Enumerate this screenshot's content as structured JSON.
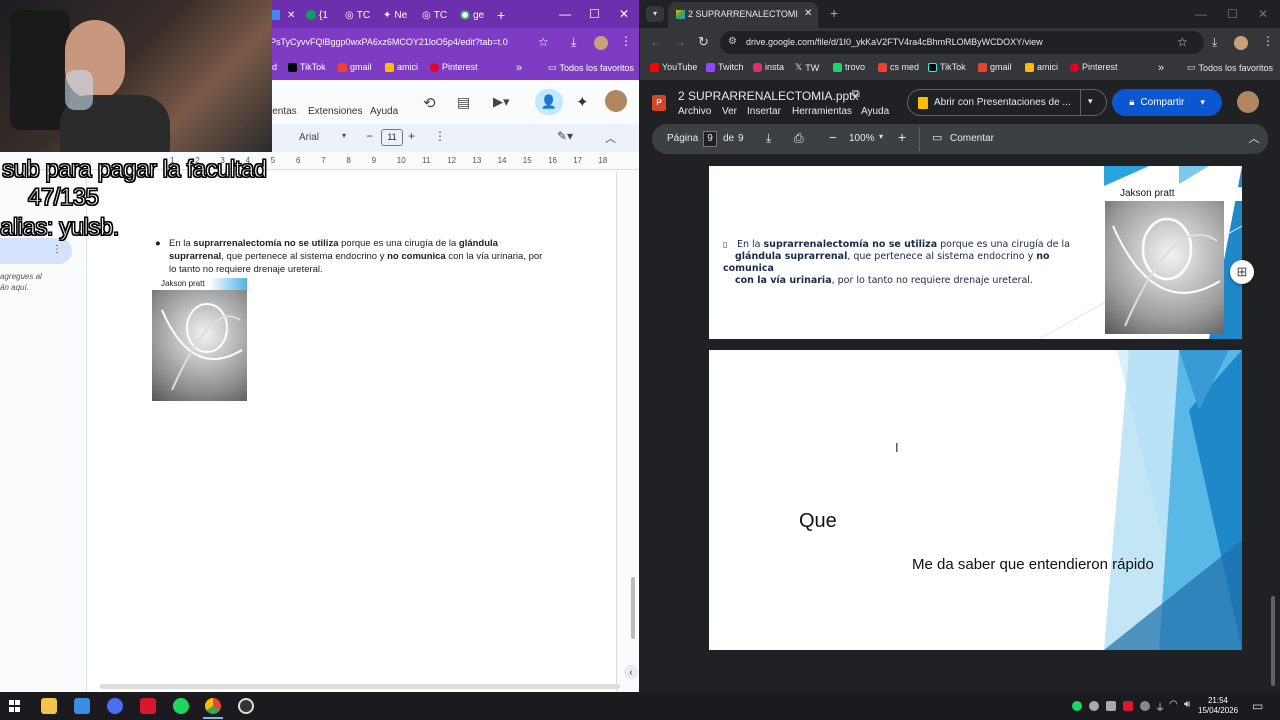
{
  "left_window": {
    "tabs": [
      {
        "label": "{1"
      },
      {
        "label": "TC"
      },
      {
        "label": "Ne"
      },
      {
        "label": "TC"
      },
      {
        "label": "ge"
      }
    ],
    "url": "PsTyCyvvFQlBggp0wxPA6xz6MCOY21loO5p4/edit?tab=t.0",
    "bookmarks": [
      {
        "label": "d"
      },
      {
        "label": "TikTok"
      },
      {
        "label": "gmail"
      },
      {
        "label": "amici"
      },
      {
        "label": "Pinterest"
      }
    ],
    "all_bookmarks": "Todos los favoritos",
    "menu": [
      "ientas",
      "Extensiones",
      "Ayuda"
    ],
    "toolbar": {
      "font": "Arial",
      "font_size": "11"
    },
    "ruler_numbers": [
      "1",
      "2",
      "3",
      "4",
      "5",
      "6",
      "7",
      "8",
      "9",
      "10",
      "11",
      "12",
      "13",
      "14",
      "15",
      "16",
      "17",
      "18"
    ],
    "sidebar_hint_1": "agregues al",
    "sidebar_hint_2": "án aquí.",
    "doc": {
      "p_a": "En la ",
      "p_b": "suprarrenalectomía no se utiliza",
      "p_c": " porque es una cirugía de la ",
      "p_d": "glándula",
      "p_e": "suprarrenal",
      "p_f": ", que pertenece al sistema endocrino y ",
      "p_g": "no comunica",
      "p_h": " con la vía urinaria,",
      "p_i": "por lo tanto no requiere drenaje ureteral.",
      "image_caption": "Jakson pratt"
    }
  },
  "overlay": {
    "line1": "sub para pagar la facultad",
    "line2": "47/135",
    "line3": "alias: yulsb."
  },
  "right_window": {
    "tab_title": "2 SUPRARRENALECTOMIA.pptx",
    "url": "drive.google.com/file/d/1I0_ykKaV2FTV4ra4cBhmRLOMByWCDOXY/view",
    "bookmarks": [
      {
        "label": "YouTube",
        "color": "#ff0000"
      },
      {
        "label": "Twitch",
        "color": "#9146ff"
      },
      {
        "label": "insta",
        "color": "#e1306c"
      },
      {
        "label": "TW",
        "color": "#ffffff"
      },
      {
        "label": "trovo",
        "color": "#19d66b"
      },
      {
        "label": "cs med",
        "color": "#ea4335"
      },
      {
        "label": "TikTok",
        "color": "#ffffff"
      },
      {
        "label": "gmail",
        "color": "#ea4335"
      },
      {
        "label": "amici",
        "color": "#fbbc04"
      },
      {
        "label": "Pinterest",
        "color": "#e60023"
      }
    ],
    "all_bookmarks": "Todos los favoritos",
    "file_title": "2 SUPRARRENALECTOMIA.pptx",
    "menu": [
      "Archivo",
      "Ver",
      "Insertar",
      "Herramientas",
      "Ayuda"
    ],
    "open_with": "Abrir con Presentaciones de ...",
    "share": "Compartir",
    "page_label": "Página",
    "page_current": "9",
    "page_of": "de",
    "page_total": "9",
    "zoom": "100%",
    "comment": "Comentar",
    "slide1": {
      "caption": "Jakson pratt",
      "t_a": "En la ",
      "t_b": "suprarrenalectomía no se utiliza",
      "t_c": "  porque es una cirugía de la",
      "t_d": "glándula suprarrenal",
      "t_e": ", que pertenece al sistema endocrino y ",
      "t_f": "no comunica",
      "t_g": "con la vía urinaria",
      "t_h": ", por lo tanto no requiere drenaje ureteral."
    },
    "slide2": {
      "title": "Que",
      "subtitle": "Me da saber que entendieron rápido"
    }
  },
  "taskbar": {
    "time": "21:54",
    "date": "15/04/2026"
  },
  "colors": {
    "purple_theme": "#7e3bc4",
    "dark_chrome": "#202124",
    "share_blue": "#0b57d0",
    "slide_blue": "#1e88c8"
  }
}
